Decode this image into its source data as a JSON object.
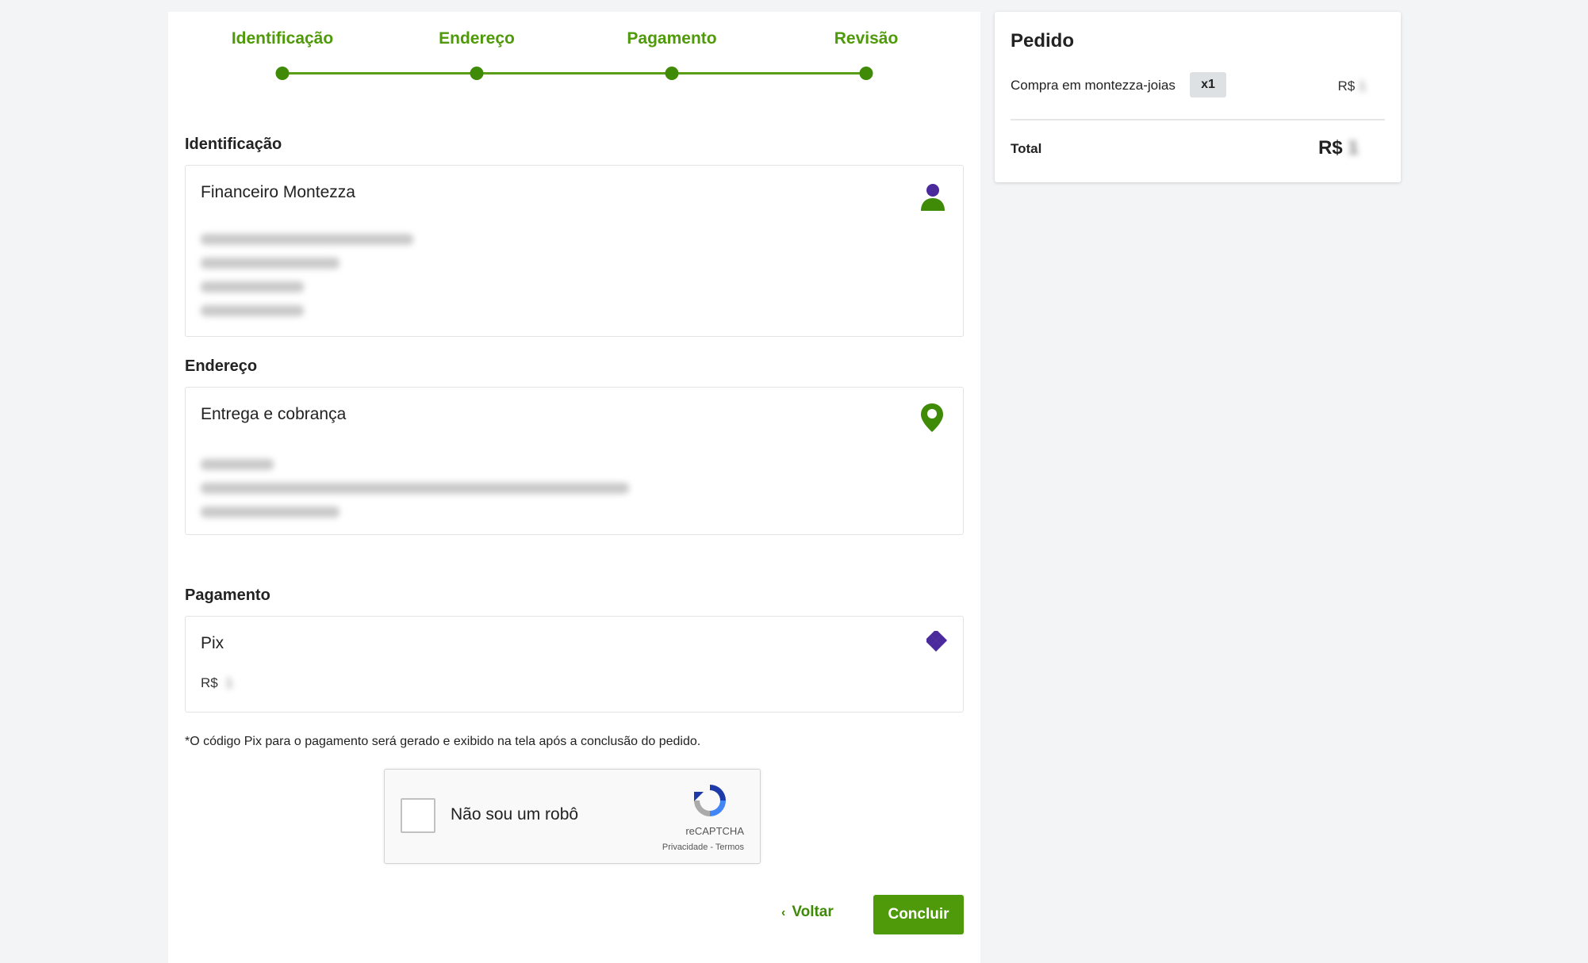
{
  "stepper": {
    "steps": [
      {
        "label": "Identificação"
      },
      {
        "label": "Endereço"
      },
      {
        "label": "Pagamento"
      },
      {
        "label": "Revisão"
      }
    ]
  },
  "identification": {
    "section_title": "Identificação",
    "name": "Financeiro Montezza",
    "icon": "user-icon"
  },
  "address": {
    "section_title": "Endereço",
    "card_title": "Entrega e cobrança",
    "icon": "map-pin-icon"
  },
  "payment": {
    "section_title": "Pagamento",
    "method": "Pix",
    "amount_prefix": "R$",
    "icon": "pix-icon"
  },
  "note": "*O código Pix para o pagamento será gerado e exibido na tela após a conclusão do pedido.",
  "recaptcha": {
    "label": "Não sou um robô",
    "brand": "reCAPTCHA",
    "links": "Privacidade - Termos"
  },
  "actions": {
    "back_label": "Voltar",
    "submit_label": "Concluir"
  },
  "order": {
    "title": "Pedido",
    "item_label": "Compra em montezza-joias",
    "quantity": "x1",
    "item_price_prefix": "R$",
    "total_label": "Total",
    "total_prefix": "R$"
  },
  "colors": {
    "accent_green": "#4f9a0a",
    "user_icon_purple": "#4b2a9c",
    "page_background": "#f3f4f6"
  }
}
